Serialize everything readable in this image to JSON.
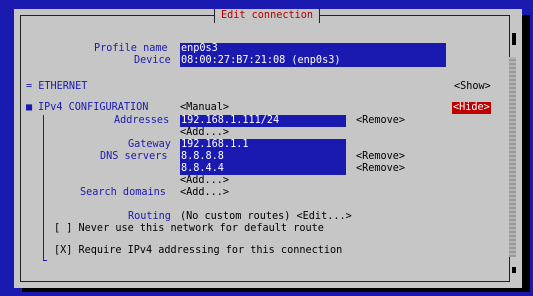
{
  "dialog": {
    "title": "Edit connection"
  },
  "profile": {
    "profile_name_label": "Profile name",
    "profile_name_value": "enp0s3",
    "device_label": "Device",
    "device_value": "08:00:27:B7:21:08 (enp0s3)"
  },
  "ethernet": {
    "label": "= ETHERNET",
    "show": "<Show>"
  },
  "ipv4": {
    "label": "IPv4 CONFIGURATION",
    "mode": "<Manual>",
    "hide": "<Hide>",
    "addresses_label": "Addresses",
    "address_value": "192.168.1.111/24",
    "address_remove": "<Remove>",
    "addresses_add": "<Add...>",
    "gateway_label": "Gateway",
    "gateway_value": "192.168.1.1",
    "dns_label": "DNS servers",
    "dns": [
      {
        "value": "8.8.8.8",
        "remove": "<Remove>"
      },
      {
        "value": "8.8.4.4",
        "remove": "<Remove>"
      }
    ],
    "dns_add": "<Add...>",
    "search_label": "Search domains",
    "search_add": "<Add...>",
    "routing_label": "Routing",
    "routing_value": "(No custom routes) <Edit...>",
    "never_default": "[ ] Never use this network for default route",
    "require_ipv4": "[X] Require IPv4 addressing for this connection"
  },
  "colors": {
    "background": "#1a1ab0",
    "dialog": "#c6c6c6",
    "title": "#b00000",
    "hide": "#c00000"
  }
}
